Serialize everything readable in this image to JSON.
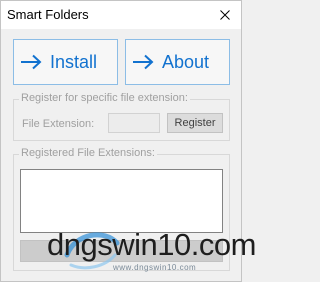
{
  "window": {
    "title": "Smart Folders"
  },
  "actions": {
    "install_label": "Install",
    "about_label": "About"
  },
  "register_group": {
    "title": "Register for specific file extension:",
    "field_label": "File Extension:",
    "field_value": "",
    "register_label": "Register"
  },
  "registered_group": {
    "title": "Registered File Extensions:",
    "items": [],
    "unregister_label": ""
  },
  "watermark": {
    "text": "dngswin10.com",
    "subtext": "www.dngswin10.com"
  },
  "colors": {
    "accent": "#1272cf",
    "button_border": "#8cbde6",
    "disabled_text": "#a0a0a0"
  },
  "icons": {
    "install": "arrow-right-icon",
    "about": "arrow-right-icon",
    "close": "close-icon"
  }
}
